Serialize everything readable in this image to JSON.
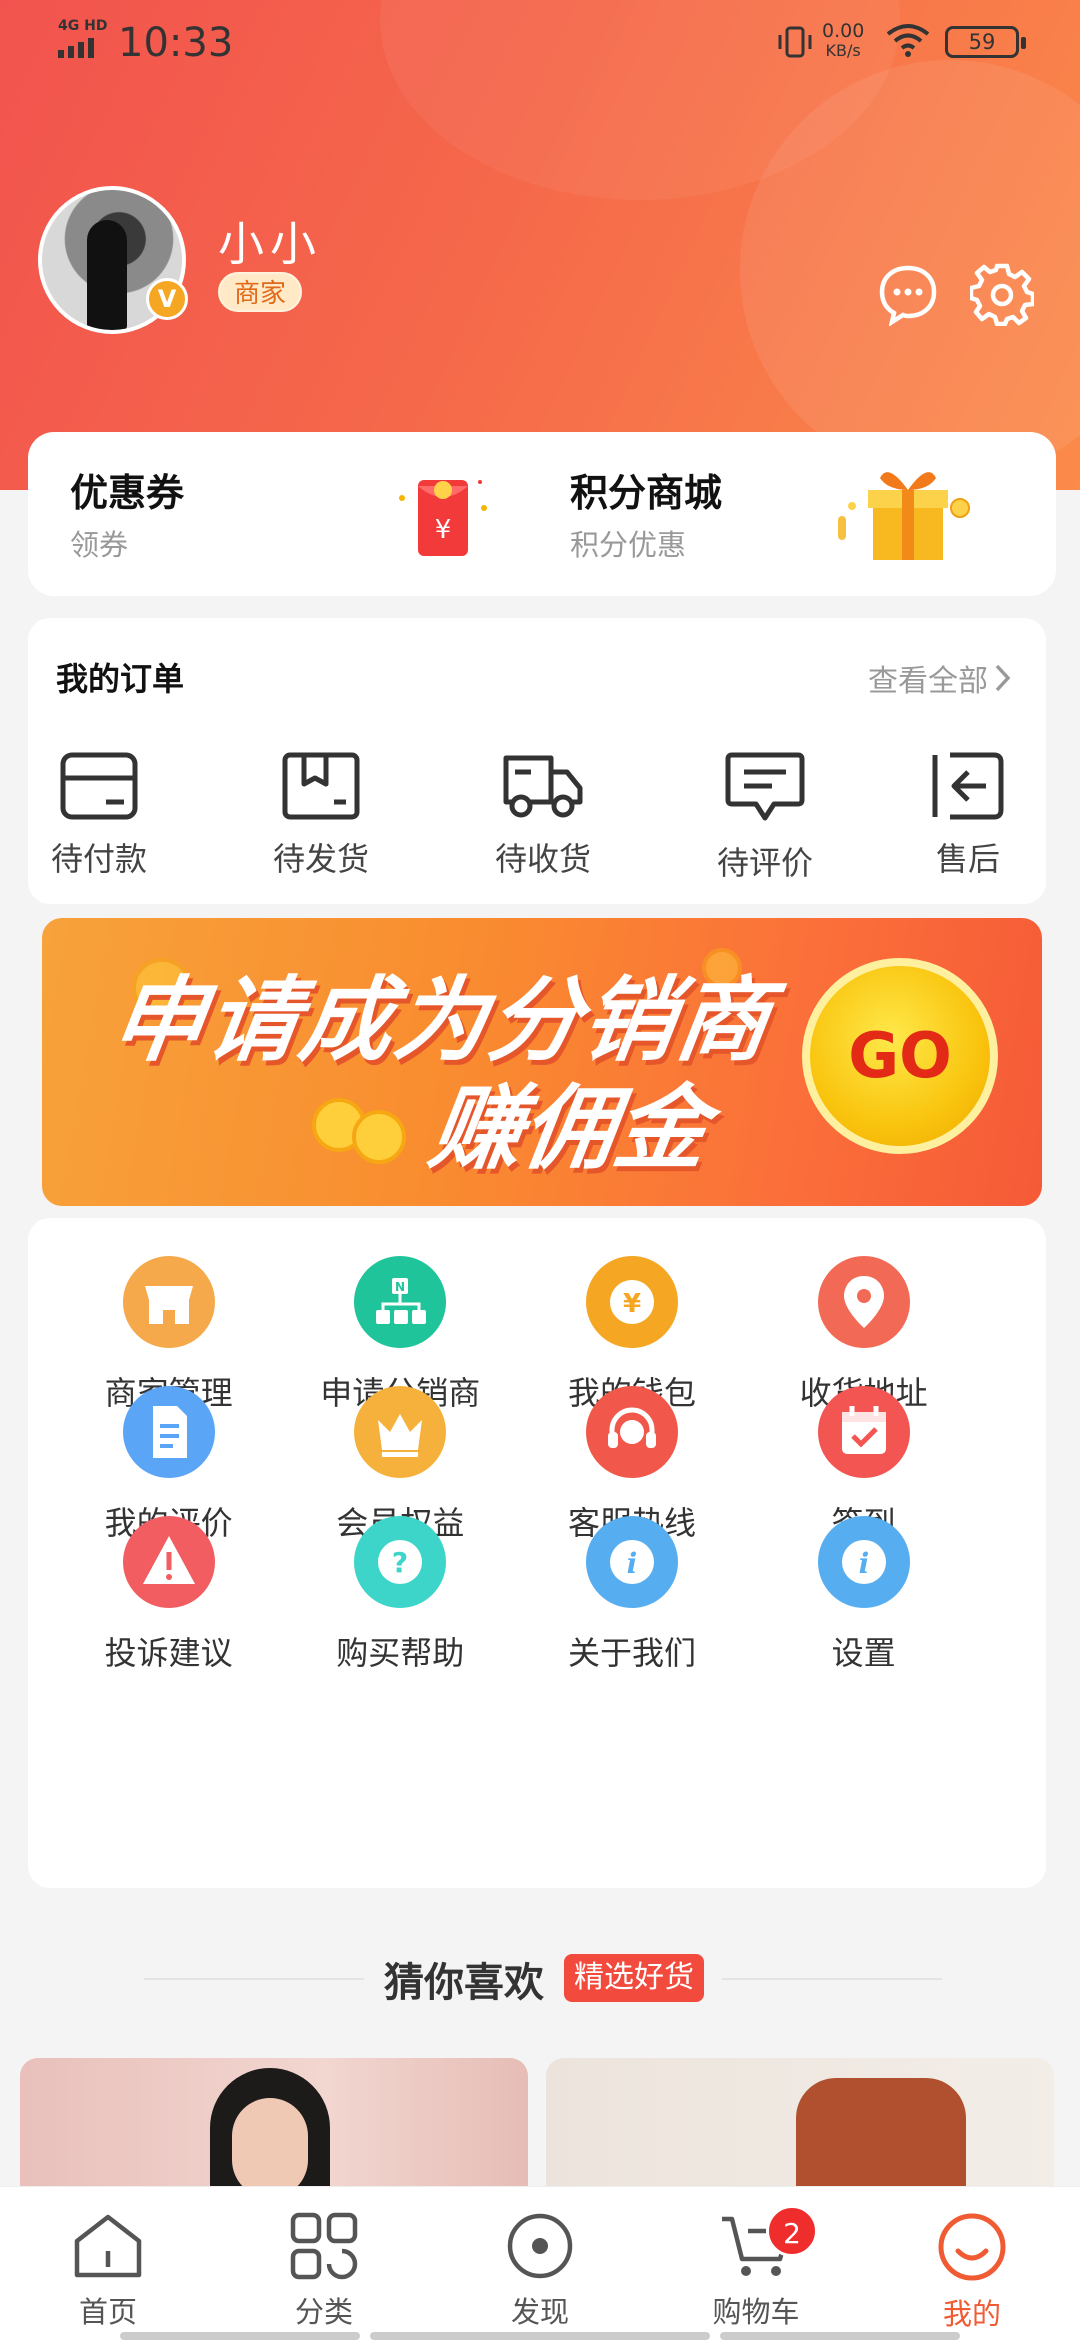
{
  "status_bar": {
    "network": "4G HD",
    "time": "10:33",
    "speed_value": "0.00",
    "speed_unit": "KB/s",
    "battery": "59"
  },
  "profile": {
    "name": "小小",
    "role_tag": "商家",
    "verified_badge": "V"
  },
  "header_icons": [
    "message-icon",
    "settings-icon"
  ],
  "promo": {
    "coupon": {
      "title": "优惠券",
      "subtitle": "领券"
    },
    "points_mall": {
      "title": "积分商城",
      "subtitle": "积分优惠"
    }
  },
  "orders": {
    "title": "我的订单",
    "view_all": "查看全部",
    "items": [
      {
        "label": "待付款",
        "icon": "wallet-icon"
      },
      {
        "label": "待发货",
        "icon": "box-icon"
      },
      {
        "label": "待收货",
        "icon": "truck-icon"
      },
      {
        "label": "待评价",
        "icon": "comment-icon"
      },
      {
        "label": "售后",
        "icon": "return-icon"
      }
    ]
  },
  "banner": {
    "line1": "申请成为分销商",
    "line2": "赚佣金",
    "cta": "GO"
  },
  "services": [
    {
      "label": "商家管理",
      "icon": "store-icon",
      "color": "#f5a94a"
    },
    {
      "label": "申请分销商",
      "icon": "network-icon",
      "color": "#20c49a"
    },
    {
      "label": "我的钱包",
      "icon": "yen-coin-icon",
      "color": "#f5a623"
    },
    {
      "label": "收货地址",
      "icon": "location-pin-icon",
      "color": "#f26a55"
    },
    {
      "label": "我的评价",
      "icon": "document-icon",
      "color": "#5aa5f5"
    },
    {
      "label": "会员权益",
      "icon": "crown-icon",
      "color": "#f5b13c"
    },
    {
      "label": "客服热线",
      "icon": "headset-icon",
      "color": "#f1574a"
    },
    {
      "label": "签到",
      "icon": "calendar-check-icon",
      "color": "#f25552"
    },
    {
      "label": "投诉建议",
      "icon": "warning-icon",
      "color": "#f25d62"
    },
    {
      "label": "购买帮助",
      "icon": "question-icon",
      "color": "#3dd5c9"
    },
    {
      "label": "关于我们",
      "icon": "info-icon",
      "color": "#56aef0"
    },
    {
      "label": "设置",
      "icon": "info-icon",
      "color": "#56aef0"
    }
  ],
  "recommend": {
    "title": "猜你喜欢",
    "tag": "精选好货"
  },
  "tabbar": {
    "items": [
      {
        "label": "首页",
        "icon": "home-icon"
      },
      {
        "label": "分类",
        "icon": "category-icon"
      },
      {
        "label": "发现",
        "icon": "discover-icon"
      },
      {
        "label": "购物车",
        "icon": "cart-icon",
        "badge": "2"
      },
      {
        "label": "我的",
        "icon": "profile-smile-icon"
      }
    ]
  },
  "colors": {
    "accent": "#f05b34",
    "header_start": "#f2534e",
    "header_end": "#fb8b4a"
  }
}
